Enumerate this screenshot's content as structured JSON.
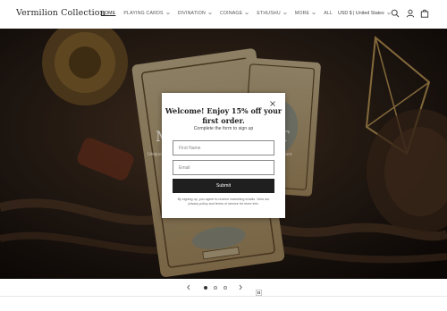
{
  "header": {
    "logo": "Vermilion Collection",
    "nav": [
      {
        "label": "HOME",
        "active": true,
        "dropdown": false
      },
      {
        "label": "PLAYING CARDS",
        "active": false,
        "dropdown": true
      },
      {
        "label": "DIVINATION",
        "active": false,
        "dropdown": true
      },
      {
        "label": "COINAGE",
        "active": false,
        "dropdown": true
      },
      {
        "label": "ETHUSHU",
        "active": false,
        "dropdown": true
      },
      {
        "label": "MORE",
        "active": false,
        "dropdown": true
      },
      {
        "label": "ALL",
        "active": false,
        "dropdown": false
      }
    ],
    "country": "USD $ | United States",
    "icons": [
      "search-icon",
      "account-icon",
      "cart-icon"
    ]
  },
  "hero": {
    "headline_left": "M",
    "headline_right": "T",
    "sub_left": "Unique",
    "sub_right": "ture"
  },
  "popup": {
    "title_line1": "Welcome! Enjoy 15% off your",
    "title_line2": "first order.",
    "subtitle": "Complete the form to sign up",
    "first_name_placeholder": "First Name",
    "email_placeholder": "Email",
    "submit_label": "Submit",
    "disclaimer": "By signing up, you agree to receive marketing emails. View our privacy policy and terms of service for more info."
  },
  "slider": {
    "slide_count": 3,
    "current_slide": 1,
    "icons": [
      "chevron-left-icon",
      "chevron-right-icon",
      "pause-icon"
    ]
  },
  "colors": {
    "submit_bg": "#1f1f1f",
    "popup_bg": "#ffffff",
    "hero_dark": "#2a1e15"
  }
}
